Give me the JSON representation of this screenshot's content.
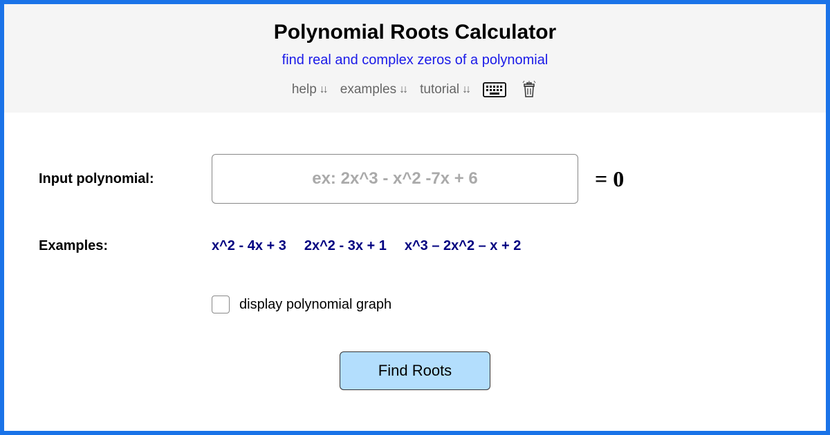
{
  "header": {
    "title": "Polynomial Roots Calculator",
    "subtitle": "find real and complex zeros of a polynomial",
    "nav": {
      "help": "help",
      "examples": "examples",
      "tutorial": "tutorial"
    }
  },
  "main": {
    "input_label": "Input polynomial:",
    "input_placeholder": "ex: 2x^3 - x^2 -7x + 6",
    "input_value": "",
    "equals_text": "= 0",
    "examples_label": "Examples:",
    "examples": [
      "x^2 - 4x + 3",
      "2x^2 - 3x + 1",
      "x^3 – 2x^2 – x + 2"
    ],
    "checkbox_label": "display polynomial graph",
    "checkbox_checked": false,
    "button_label": "Find Roots"
  }
}
